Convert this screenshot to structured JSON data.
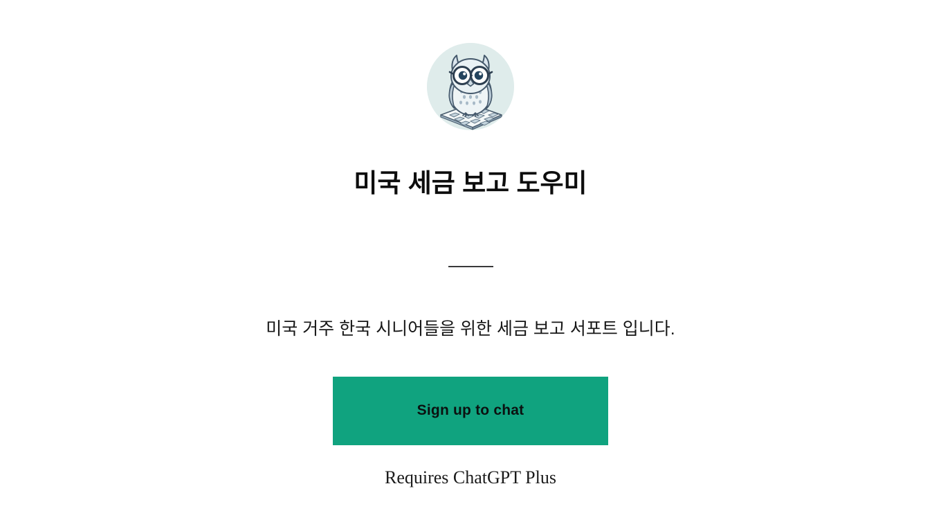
{
  "logo": {
    "icon": "owl-with-glasses-on-calculator-icon",
    "circle_color": "#dfeceb",
    "alt": "owl wearing glasses perched on a calculator"
  },
  "header": {
    "title": "미국 세금 보고 도우미"
  },
  "divider": {
    "color": "#39393a"
  },
  "main": {
    "description": "미국 거주 한국 시니어들을 위한 세금 보고 서포트 입니다."
  },
  "cta": {
    "label": "Sign up to chat",
    "background_color": "#10a37f",
    "text_color": "#0b1110"
  },
  "footer": {
    "note": "Requires ChatGPT Plus"
  }
}
